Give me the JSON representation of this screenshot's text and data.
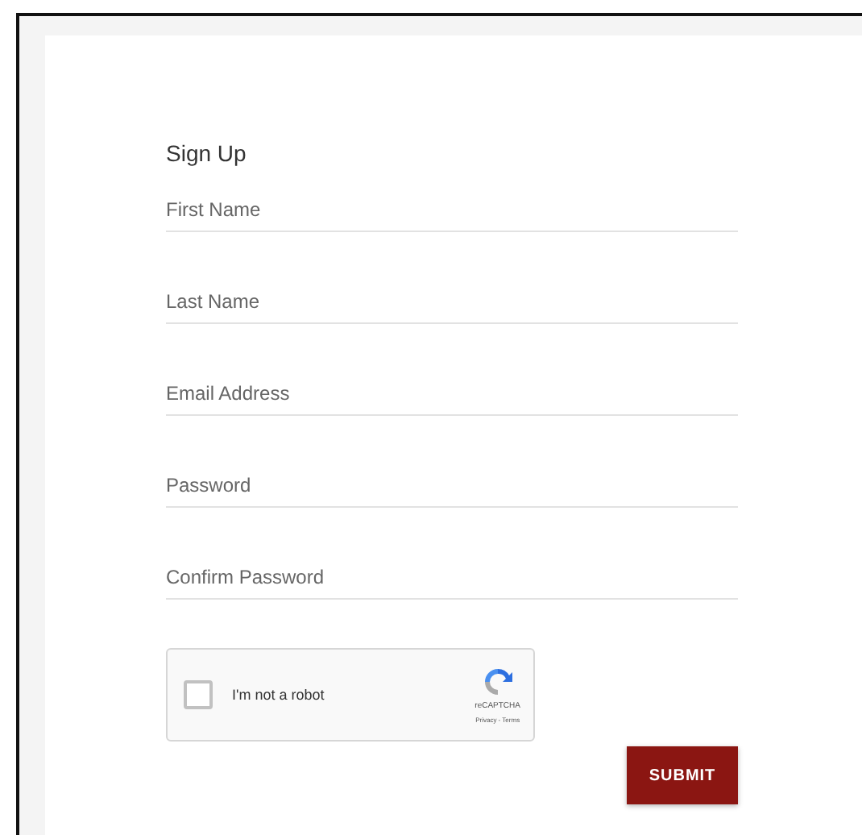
{
  "form": {
    "title": "Sign Up",
    "fields": [
      {
        "placeholder": "First Name"
      },
      {
        "placeholder": "Last Name"
      },
      {
        "placeholder": "Email Address"
      },
      {
        "placeholder": "Password"
      },
      {
        "placeholder": "Confirm Password"
      }
    ],
    "captcha": {
      "label": "I'm not a robot",
      "checked": false,
      "brand": "reCAPTCHA",
      "links": "Privacy - Terms"
    },
    "submit": "SUBMIT"
  }
}
